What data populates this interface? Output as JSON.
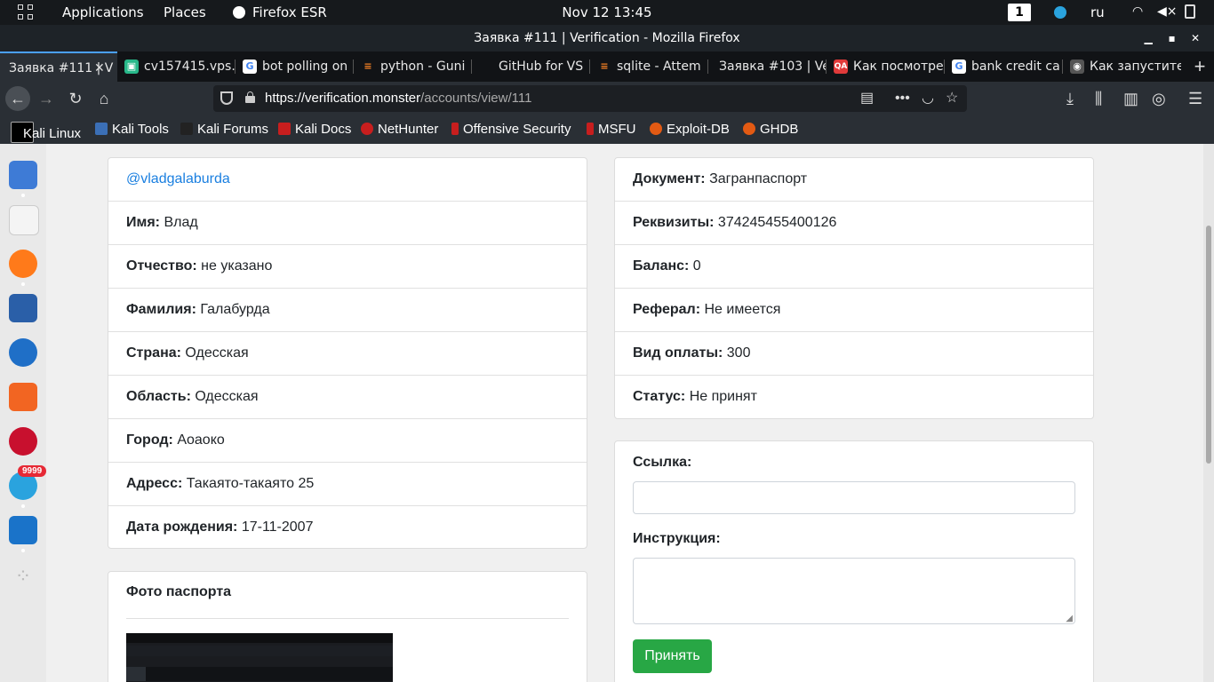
{
  "topbar": {
    "applications": "Applications",
    "places": "Places",
    "browser": "Firefox ESR",
    "datetime": "Nov 12  13:45",
    "workspace": "1",
    "lang": "ru"
  },
  "window": {
    "title": "Заявка #111 | Verification - Mozilla Firefox"
  },
  "tabs": [
    {
      "label": "Заявка #111 | V",
      "active": true,
      "fav": "",
      "favcolor": ""
    },
    {
      "label": "cv157415.vps.",
      "fav": "▣",
      "favcolor": "#28b88a"
    },
    {
      "label": "bot polling on",
      "fav": "G",
      "favcolor": "#4285f4"
    },
    {
      "label": "python - Guni",
      "fav": "≡",
      "favcolor": "#f48024"
    },
    {
      "label": "GitHub for VS",
      "fav": "",
      "favcolor": "#111316"
    },
    {
      "label": "sqlite - Attem",
      "fav": "≡",
      "favcolor": "#f48024"
    },
    {
      "label": "Заявка #103 | Ve",
      "fav": "",
      "favcolor": "#111316"
    },
    {
      "label": "Как посмотре",
      "fav": "QA",
      "favcolor": "#e03a3a"
    },
    {
      "label": "bank credit ca",
      "fav": "G",
      "favcolor": "#4285f4"
    },
    {
      "label": "Как запустите",
      "fav": "◉",
      "favcolor": "#666"
    }
  ],
  "url": {
    "host": "https://verification.monster",
    "path": "/accounts/view/111"
  },
  "bookmarks": [
    "Kali Linux",
    "Kali Tools",
    "Kali Forums",
    "Kali Docs",
    "NetHunter",
    "Offensive Security",
    "MSFU",
    "Exploit-DB",
    "GHDB"
  ],
  "dock": {
    "badge": "9999"
  },
  "account": {
    "username": "@vladgalaburda",
    "rows": [
      {
        "label": "Имя:",
        "value": " Влад"
      },
      {
        "label": "Отчество:",
        "value": " не указано"
      },
      {
        "label": "Фамилия:",
        "value": " Галабурда"
      },
      {
        "label": "Страна:",
        "value": " Одесская"
      },
      {
        "label": "Область:",
        "value": " Одесская"
      },
      {
        "label": "Город:",
        "value": " Аоаоко"
      },
      {
        "label": "Адресс:",
        "value": " Такаято-такаято 25"
      },
      {
        "label": "Дата рождения:",
        "value": " 17-11-2007"
      }
    ]
  },
  "details": {
    "rows": [
      {
        "label": "Документ:",
        "value": " Загранпаспорт"
      },
      {
        "label": "Реквизиты:",
        "value": " 374245455400126"
      },
      {
        "label": "Баланс:",
        "value": " 0"
      },
      {
        "label": "Реферал:",
        "value": " Не имеется"
      },
      {
        "label": "Вид оплаты:",
        "value": " 300"
      },
      {
        "label": "Статус:",
        "value": " Не принят"
      }
    ]
  },
  "passport": {
    "title": "Фото паспорта"
  },
  "form": {
    "link_label": "Ссылка:",
    "instruction_label": "Инструкция:",
    "submit": "Принять"
  }
}
